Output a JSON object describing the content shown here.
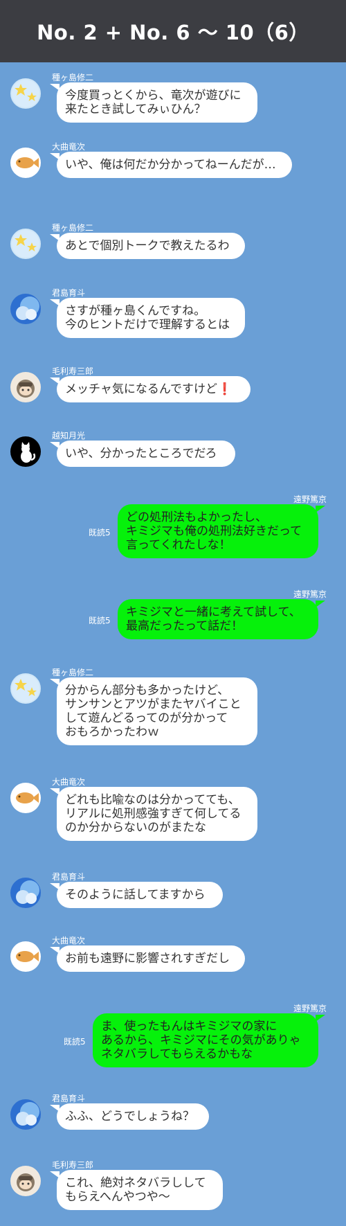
{
  "header": {
    "title": "No. 2 + No. 6 ～ 10（6）"
  },
  "messages": [
    {
      "sender": "種ヶ島修二",
      "avatar": "stars-avatar",
      "lines": [
        "今度買っとくから、竜次が遊びに",
        "来たとき試してみぃひん？"
      ]
    },
    {
      "sender": "大曲竜次",
      "avatar": "taiyaki-avatar",
      "lines": [
        "いや、俺は何だか分かってねーんだが…"
      ]
    },
    {
      "sender": "種ヶ島修二",
      "avatar": "stars-avatar",
      "lines": [
        "あとで個別トークで教えたるわ"
      ]
    },
    {
      "sender": "君島育斗",
      "avatar": "sky-avatar",
      "lines": [
        "さすが種ヶ島くんですね。",
        "今のヒントだけで理解するとは"
      ]
    },
    {
      "sender": "毛利寿三郎",
      "avatar": "character-avatar",
      "lines": [
        "メッチャ気になるんですけど"
      ],
      "emoji": "❗"
    },
    {
      "sender": "越知月光",
      "avatar": "cat-avatar",
      "lines": [
        "いや、分かったところでだろ"
      ]
    },
    {
      "sender": "遠野篤京",
      "read": "既読5",
      "lines": [
        "どの処刑法もよかったし、",
        "キミジマも俺の処刑法好きだって",
        "言ってくれたしな！"
      ]
    },
    {
      "sender": "遠野篤京",
      "read": "既読5",
      "lines": [
        "キミジマと一緒に考えて試して、",
        "最高だったって話だ！"
      ]
    },
    {
      "sender": "種ヶ島修二",
      "avatar": "stars-avatar",
      "lines": [
        "分からん部分も多かったけど、",
        "サンサンとアツがまたヤバイこと",
        "して遊んどるってのが分かって",
        "おもろかったわｗ"
      ]
    },
    {
      "sender": "大曲竜次",
      "avatar": "taiyaki-avatar",
      "lines": [
        "どれも比喩なのは分かってても、",
        "リアルに処刑感強すぎて何してる",
        "のか分からないのがまたな"
      ]
    },
    {
      "sender": "君島育斗",
      "avatar": "sky-avatar",
      "lines": [
        "そのように話してますから"
      ]
    },
    {
      "sender": "大曲竜次",
      "avatar": "taiyaki-avatar",
      "lines": [
        "お前も遠野に影響されすぎだし"
      ]
    },
    {
      "sender": "遠野篤京",
      "read": "既読5",
      "lines": [
        "ま、使ったもんはキミジマの家に",
        "あるから、キミジマにその気がありゃ",
        "ネタバラしてもらえるかもな"
      ]
    },
    {
      "sender": "君島育斗",
      "avatar": "sky-avatar",
      "lines": [
        "ふふ、どうでしょうね？"
      ]
    },
    {
      "sender": "毛利寿三郎",
      "avatar": "character-avatar",
      "lines": [
        "これ、絶対ネタバラしして",
        "もらえへんやつや〜"
      ]
    }
  ],
  "colors": {
    "background": "#6a9fd6",
    "header": "#3c3d42",
    "my_bubble": "#06f10b",
    "other_bubble": "#ffffff"
  }
}
